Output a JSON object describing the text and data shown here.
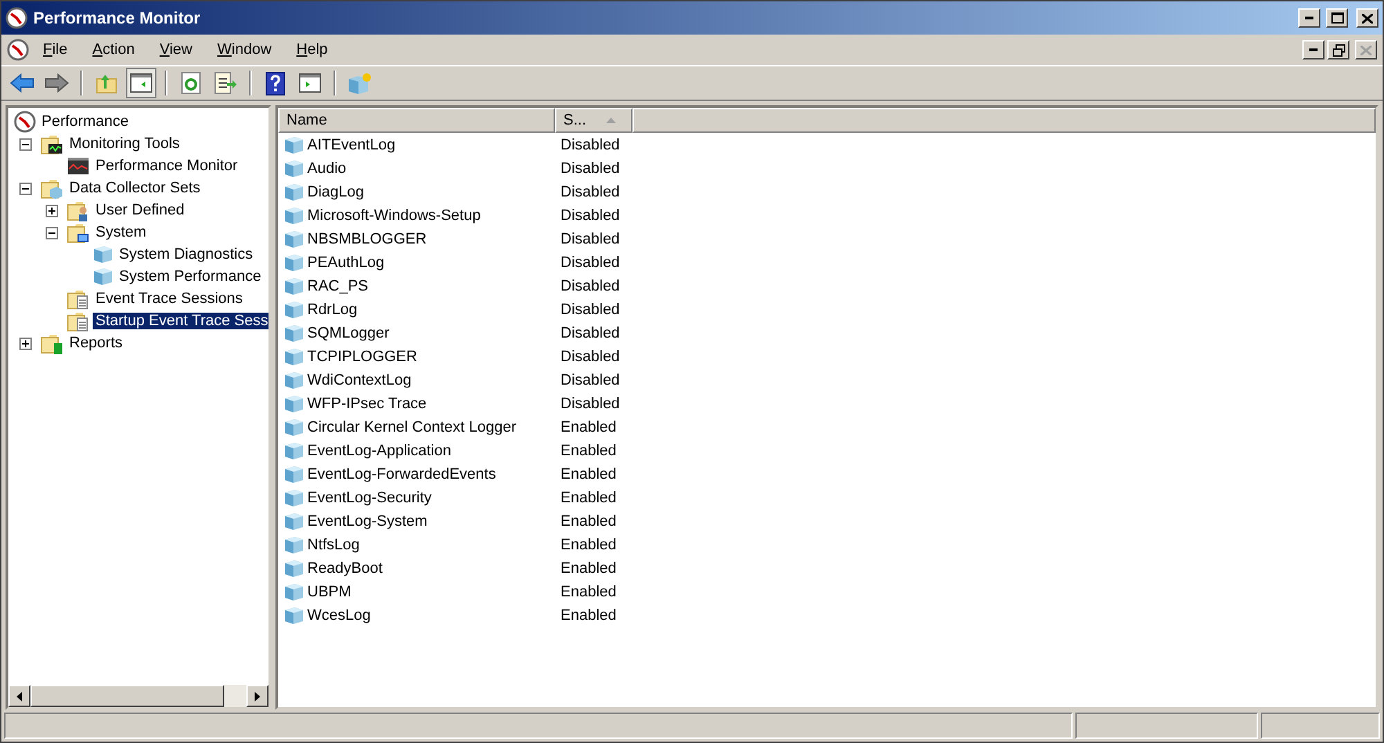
{
  "window": {
    "title": "Performance Monitor"
  },
  "menu": [
    {
      "label": "File"
    },
    {
      "label": "Action"
    },
    {
      "label": "View"
    },
    {
      "label": "Window"
    },
    {
      "label": "Help"
    }
  ],
  "toolbar": [
    {
      "kind": "back"
    },
    {
      "kind": "forward"
    },
    {
      "kind": "sep"
    },
    {
      "kind": "up"
    },
    {
      "kind": "pane",
      "selected": true
    },
    {
      "kind": "sep"
    },
    {
      "kind": "refresh"
    },
    {
      "kind": "export"
    },
    {
      "kind": "sep"
    },
    {
      "kind": "help"
    },
    {
      "kind": "panel"
    },
    {
      "kind": "sep"
    },
    {
      "kind": "new"
    }
  ],
  "tree": [
    {
      "label": "Performance",
      "selected": false,
      "children": [
        {
          "label": "Monitoring Tools",
          "selected": false,
          "expanded": true,
          "children": [
            {
              "label": "Performance Monitor",
              "selected": false
            }
          ]
        },
        {
          "label": "Data Collector Sets",
          "selected": false,
          "expanded": true,
          "children": [
            {
              "label": "User Defined",
              "selected": false,
              "expanded": false
            },
            {
              "label": "System",
              "selected": false,
              "expanded": true,
              "children": [
                {
                  "label": "System Diagnostics",
                  "selected": false
                },
                {
                  "label": "System Performance",
                  "selected": false
                }
              ]
            },
            {
              "label": "Event Trace Sessions",
              "selected": false
            },
            {
              "label": "Startup Event Trace Sess",
              "selected": true
            }
          ]
        },
        {
          "label": "Reports",
          "selected": false,
          "expanded": false
        }
      ]
    }
  ],
  "table": {
    "columns": [
      {
        "label": "Name",
        "sorted": false
      },
      {
        "label": "S...",
        "sorted": true
      }
    ],
    "rows": [
      {
        "name": "AITEventLog",
        "status": "Disabled"
      },
      {
        "name": "Audio",
        "status": "Disabled"
      },
      {
        "name": "DiagLog",
        "status": "Disabled"
      },
      {
        "name": "Microsoft-Windows-Setup",
        "status": "Disabled"
      },
      {
        "name": "NBSMBLOGGER",
        "status": "Disabled"
      },
      {
        "name": "PEAuthLog",
        "status": "Disabled"
      },
      {
        "name": "RAC_PS",
        "status": "Disabled"
      },
      {
        "name": "RdrLog",
        "status": "Disabled"
      },
      {
        "name": "SQMLogger",
        "status": "Disabled"
      },
      {
        "name": "TCPIPLOGGER",
        "status": "Disabled"
      },
      {
        "name": "WdiContextLog",
        "status": "Disabled"
      },
      {
        "name": "WFP-IPsec Trace",
        "status": "Disabled"
      },
      {
        "name": "Circular Kernel Context Logger",
        "status": "Enabled"
      },
      {
        "name": "EventLog-Application",
        "status": "Enabled"
      },
      {
        "name": "EventLog-ForwardedEvents",
        "status": "Enabled"
      },
      {
        "name": "EventLog-Security",
        "status": "Enabled"
      },
      {
        "name": "EventLog-System",
        "status": "Enabled"
      },
      {
        "name": "NtfsLog",
        "status": "Enabled"
      },
      {
        "name": "ReadyBoot",
        "status": "Enabled"
      },
      {
        "name": "UBPM",
        "status": "Enabled"
      },
      {
        "name": "WcesLog",
        "status": "Enabled"
      }
    ]
  }
}
